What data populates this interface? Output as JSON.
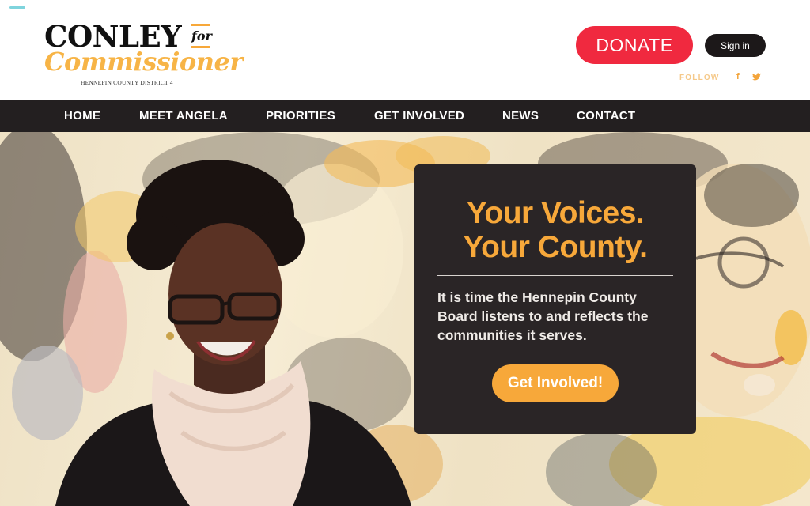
{
  "logo": {
    "name": "CONLEY",
    "for": "for",
    "role": "Commissioner",
    "district": "HENNEPIN COUNTY DISTRICT 4"
  },
  "header": {
    "donate_label": "DONATE",
    "signin_label": "Sign in",
    "follow_label": "FOLLOW",
    "facebook_glyph": "f",
    "twitter_glyph": "❧"
  },
  "nav": {
    "items": [
      "HOME",
      "MEET ANGELA",
      "PRIORITIES",
      "GET INVOLVED",
      "NEWS",
      "CONTACT"
    ]
  },
  "hero": {
    "headline_line1": "Your Voices.",
    "headline_line2": "Your County.",
    "body": "It is time the Hennepin County Board listens to and reflects the communities it serves.",
    "cta_label": "Get Involved!"
  },
  "colors": {
    "accent_orange": "#f7a83a",
    "donate_red": "#f0293f",
    "nav_dark": "#231f20",
    "card_dark": "#2a2526"
  },
  "icons": [
    "facebook-icon",
    "twitter-icon"
  ]
}
